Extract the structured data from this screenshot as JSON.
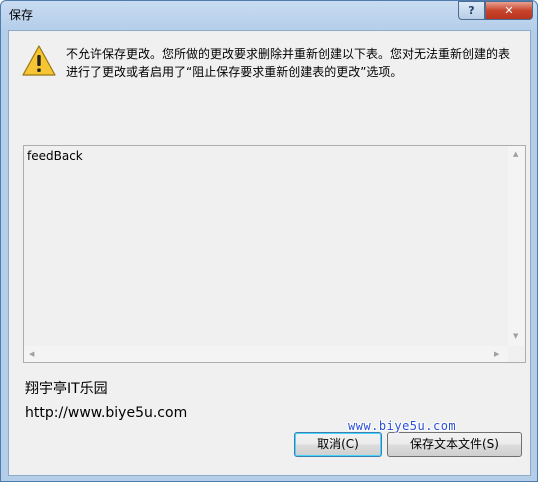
{
  "window": {
    "title": "保存",
    "help_label": "?",
    "close_label": "✕"
  },
  "dialog": {
    "icon": "warning-icon",
    "message": "不允许保存更改。您所做的更改要求删除并重新创建以下表。您对无法重新创建的表进行了更改或者启用了“阻止保存要求重新创建表的更改”选项。",
    "list_items": [
      "feedBack"
    ]
  },
  "footer": {
    "brand": "翔宇亭IT乐园",
    "url": "http://www.biye5u.com"
  },
  "buttons": {
    "cancel_label": "取消(C)",
    "save_text_label": "保存文本文件(S)"
  },
  "watermark": "www.biye5u.com",
  "colors": {
    "title_bar": "#b9d1ea",
    "client_bg": "#f0f0f0",
    "close_button": "#c7432b",
    "focus_border": "#3c7fb1",
    "watermark": "#2a4fd8"
  }
}
